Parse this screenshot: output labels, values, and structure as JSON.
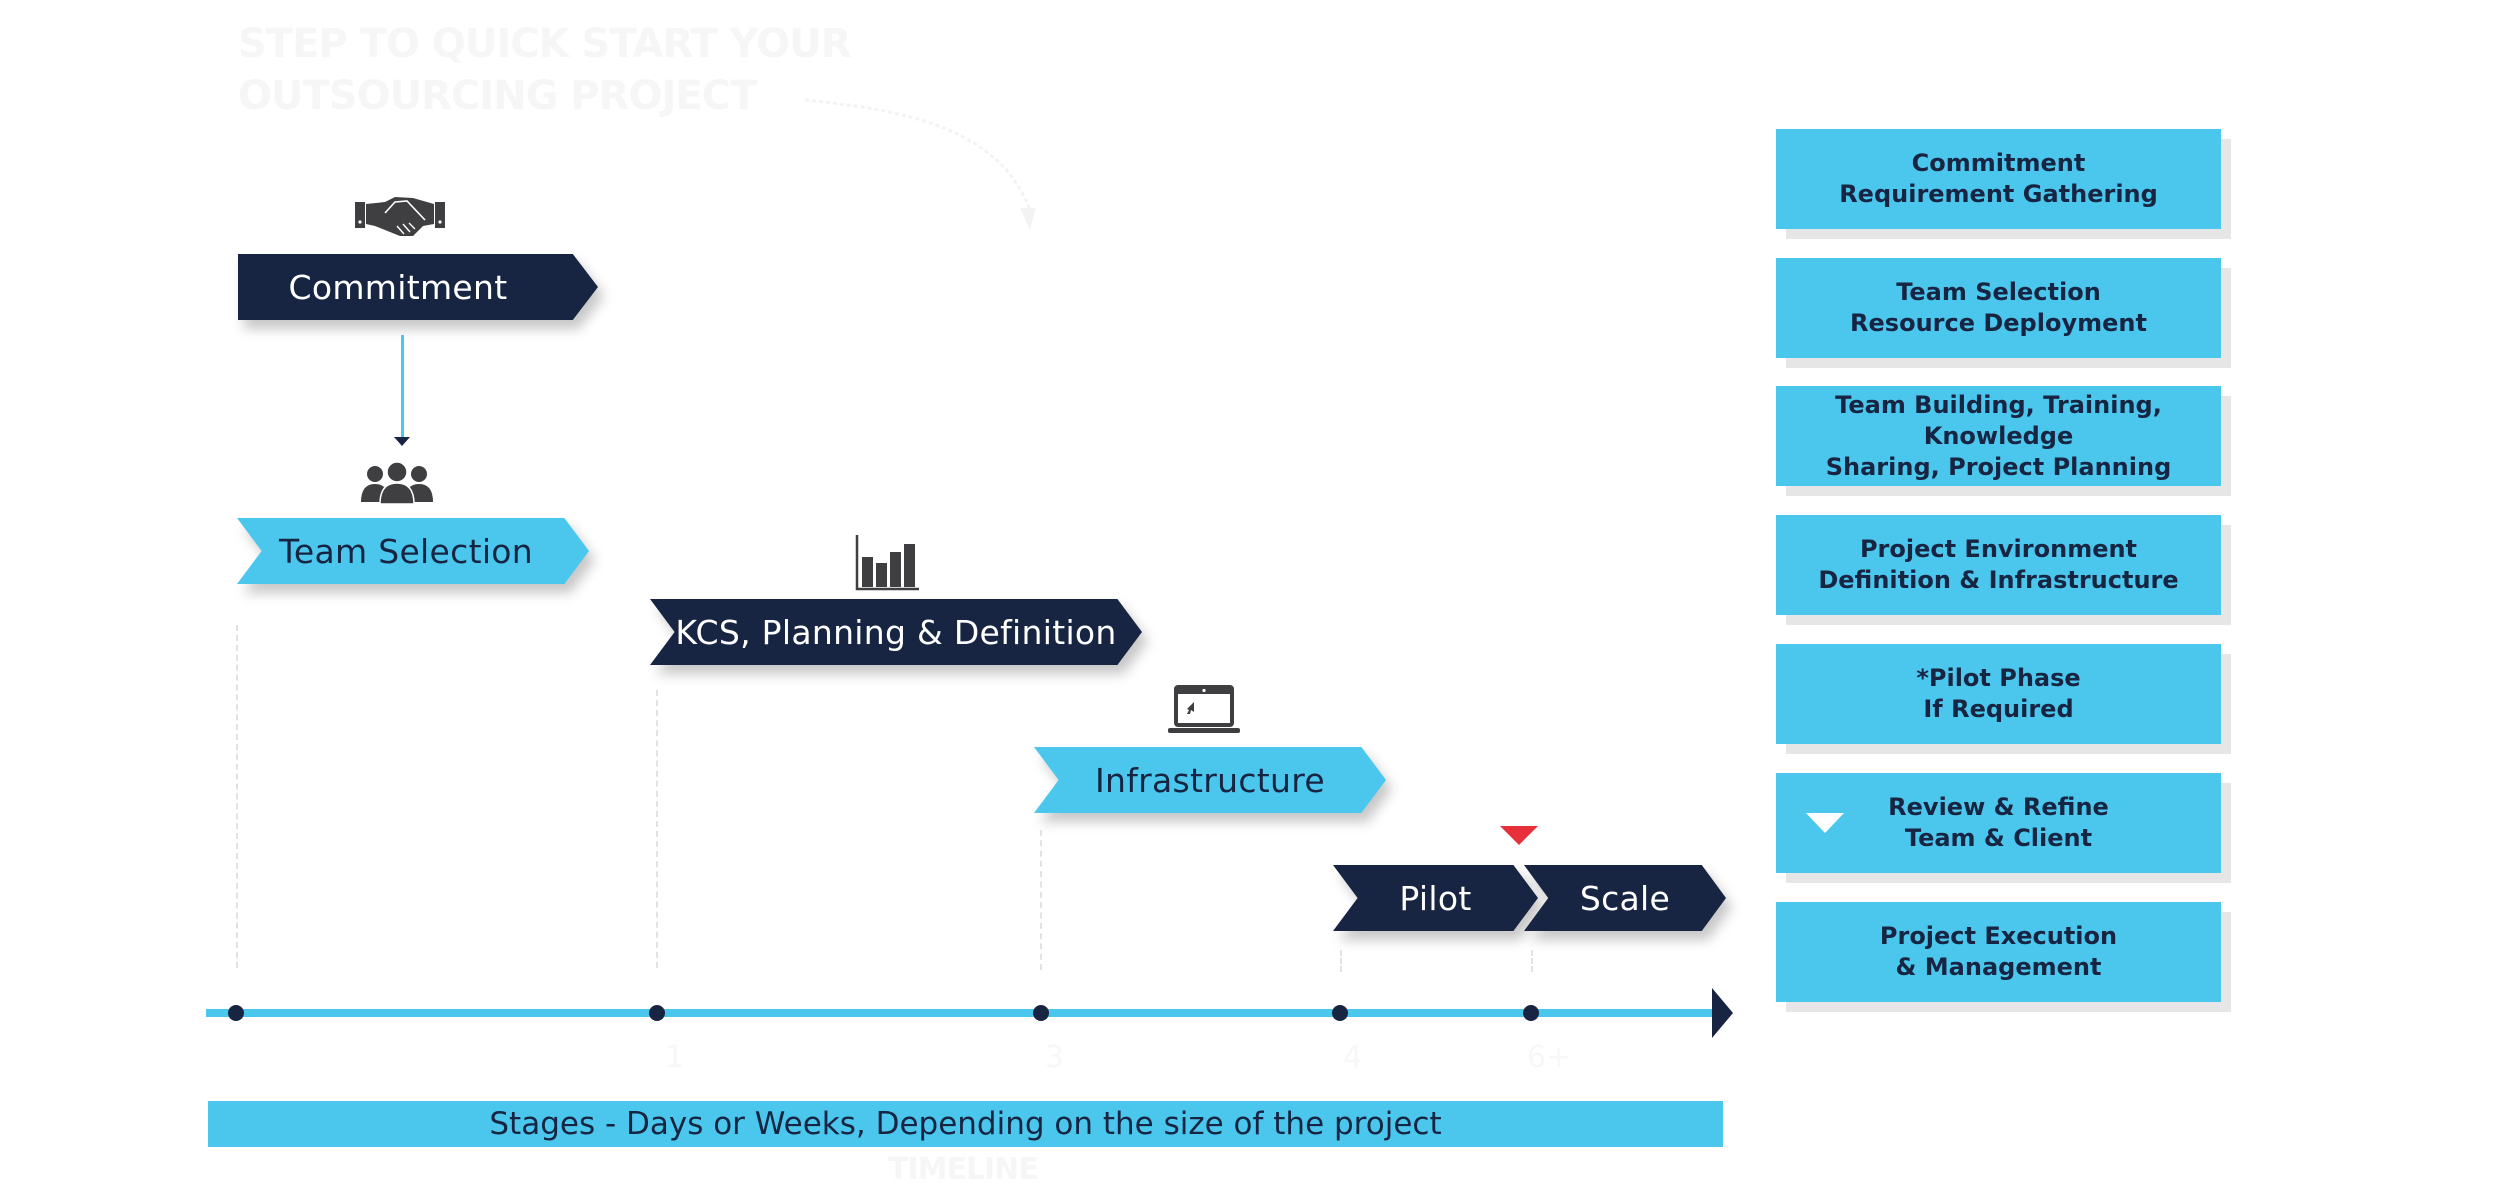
{
  "watermark": {
    "title_line1": "Step to quick start your",
    "title_line2": "outsourcing project",
    "timeline_label": "TIMELINE",
    "stage_numbers": [
      "1",
      "3",
      "4",
      "6+"
    ]
  },
  "stages": [
    {
      "label": "Commitment",
      "style": "dark",
      "icon": "handshake-icon"
    },
    {
      "label": "Team Selection",
      "style": "light",
      "icon": "team-icon"
    },
    {
      "label": "KCS, Planning & Definition",
      "style": "dark",
      "icon": "bar-chart-icon"
    },
    {
      "label": "Infrastructure",
      "style": "light",
      "icon": "laptop-icon"
    },
    {
      "label": "Pilot",
      "style": "dark",
      "icon": null
    },
    {
      "label": "Scale",
      "style": "dark",
      "icon": null
    }
  ],
  "timeline": {
    "caption": "Stages - Days or Weeks, Depending on the size of the project",
    "milestones": [
      "Commitment",
      "KCS, Planning & Definition",
      "Infrastructure",
      "Pilot",
      "Scale"
    ]
  },
  "legend_boxes": [
    {
      "line1": "Commitment",
      "line2": "Requirement Gathering"
    },
    {
      "line1": "Team Selection",
      "line2": "Resource Deployment"
    },
    {
      "line1": "Team Building, Training, Knowledge",
      "line2": "Sharing, Project Planning"
    },
    {
      "line1": "Project Environment",
      "line2": "Definition & Infrastructure"
    },
    {
      "line1": "*Pilot Phase",
      "line2": "If Required"
    },
    {
      "line1": "Review & Refine",
      "line2": "Team & Client",
      "marker": "triangle-down-icon"
    },
    {
      "line1": "Project Execution",
      "line2": "& Management"
    }
  ],
  "colors": {
    "navy": "#172543",
    "cyan": "#4bc7ed",
    "icon_grey": "#3f3f41",
    "marker_red": "#e8303a",
    "shadow_grey": "#e6e6e6"
  }
}
